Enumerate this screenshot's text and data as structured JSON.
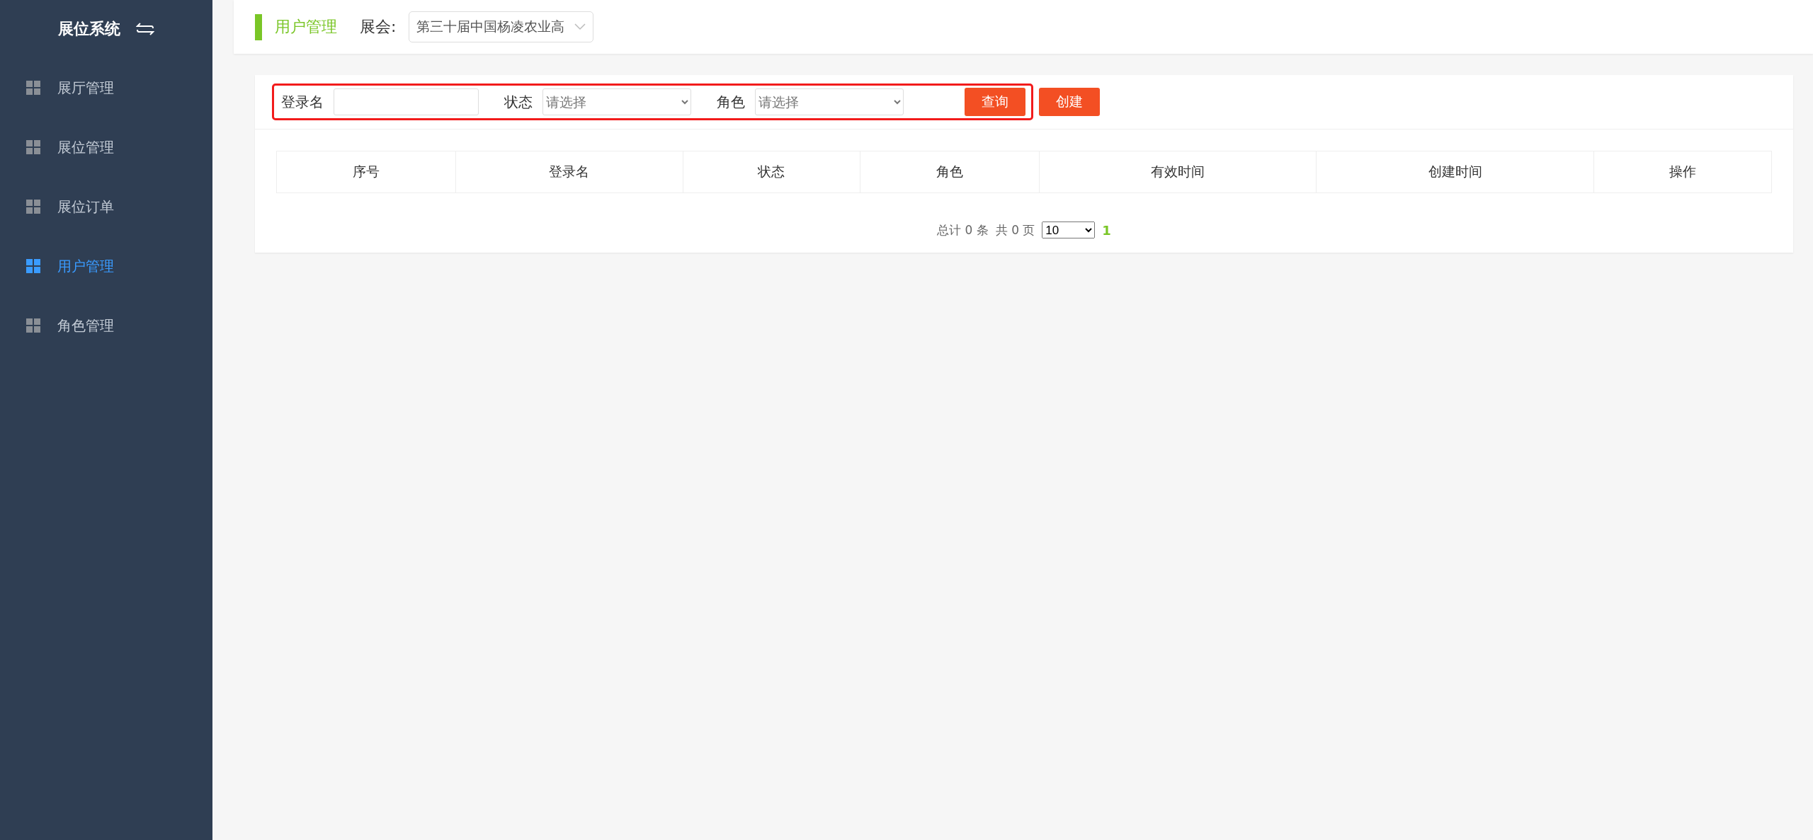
{
  "sidebar": {
    "title": "展位系统",
    "items": [
      {
        "label": "展厅管理",
        "selected": false
      },
      {
        "label": "展位管理",
        "selected": false
      },
      {
        "label": "展位订单",
        "selected": false
      },
      {
        "label": "用户管理",
        "selected": true
      },
      {
        "label": "角色管理",
        "selected": false
      }
    ]
  },
  "header": {
    "page_title": "用户管理",
    "exhibition_label": "展会:",
    "exhibition_value": "第三十届中国杨凌农业高"
  },
  "filters": {
    "fields": [
      {
        "kind": "text",
        "label": "登录名"
      },
      {
        "kind": "select",
        "label": "状态",
        "placeholder": "请选择"
      },
      {
        "kind": "select",
        "label": "角色",
        "placeholder": "请选择"
      }
    ],
    "buttons": [
      "查询",
      "创建"
    ]
  },
  "table": {
    "columns": [
      "序号",
      "登录名",
      "状态",
      "角色",
      "有效时间",
      "创建时间",
      "操作"
    ]
  },
  "pagination": {
    "total": "总计 0 条",
    "pages": "共 0 页",
    "page_size": "10",
    "current_page": "1"
  }
}
